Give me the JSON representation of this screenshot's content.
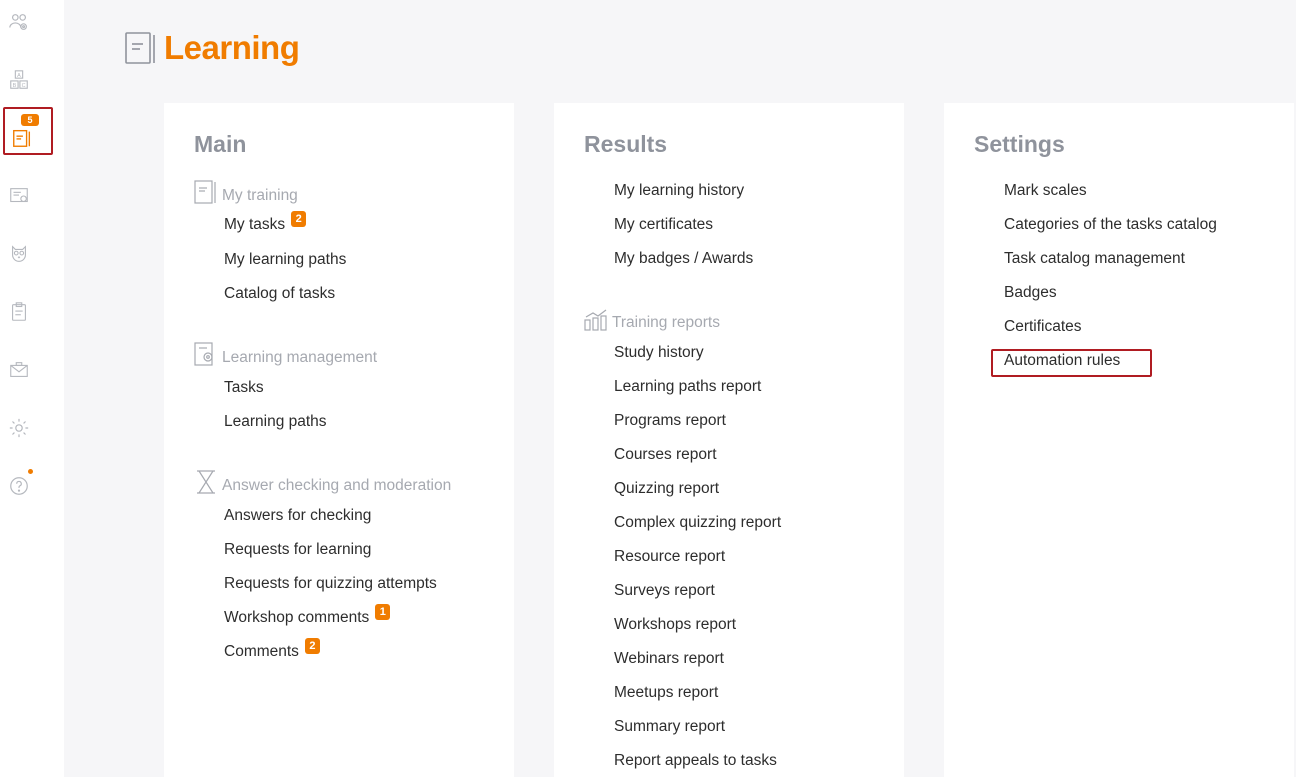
{
  "sidebar": {
    "items": [
      {
        "name": "people-gear-icon"
      },
      {
        "name": "abc-blocks-icon"
      },
      {
        "name": "learning-book-icon",
        "badge": "5",
        "active": true
      },
      {
        "name": "report-card-icon"
      },
      {
        "name": "owl-icon"
      },
      {
        "name": "clipboard-icon"
      },
      {
        "name": "envelope-icon"
      },
      {
        "name": "gear-icon"
      },
      {
        "name": "help-icon"
      }
    ]
  },
  "header": {
    "title": "Learning"
  },
  "main": {
    "title": "Main",
    "sections": [
      {
        "label": "My training",
        "links": [
          {
            "label": "My tasks",
            "badge": "2"
          },
          {
            "label": "My learning paths"
          },
          {
            "label": "Catalog of tasks"
          }
        ]
      },
      {
        "label": "Learning management",
        "links": [
          {
            "label": "Tasks"
          },
          {
            "label": "Learning paths"
          }
        ]
      },
      {
        "label": "Answer checking and moderation",
        "links": [
          {
            "label": "Answers for checking"
          },
          {
            "label": "Requests for learning"
          },
          {
            "label": "Requests for quizzing attempts"
          },
          {
            "label": "Workshop comments",
            "badge": "1"
          },
          {
            "label": "Comments",
            "badge": "2"
          }
        ]
      }
    ]
  },
  "results": {
    "title": "Results",
    "links": [
      {
        "label": "My learning history"
      },
      {
        "label": "My certificates"
      },
      {
        "label": "My badges / Awards"
      }
    ],
    "reports_section": {
      "label": "Training reports",
      "links": [
        {
          "label": "Study history"
        },
        {
          "label": "Learning paths report"
        },
        {
          "label": "Programs report"
        },
        {
          "label": "Courses report"
        },
        {
          "label": "Quizzing report"
        },
        {
          "label": "Complex quizzing report"
        },
        {
          "label": "Resource report"
        },
        {
          "label": "Surveys report"
        },
        {
          "label": "Workshops report"
        },
        {
          "label": "Webinars report"
        },
        {
          "label": "Meetups report"
        },
        {
          "label": "Summary report"
        },
        {
          "label": "Report appeals to tasks"
        }
      ]
    }
  },
  "settings": {
    "title": "Settings",
    "links": [
      {
        "label": "Mark scales"
      },
      {
        "label": "Categories of the tasks catalog"
      },
      {
        "label": "Task catalog management"
      },
      {
        "label": "Badges"
      },
      {
        "label": "Certificates"
      },
      {
        "label": "Automation rules",
        "highlighted": true
      }
    ]
  },
  "colors": {
    "accent": "#f07c00",
    "highlight_border": "#b01c22",
    "heading_gray": "#8f939c"
  }
}
